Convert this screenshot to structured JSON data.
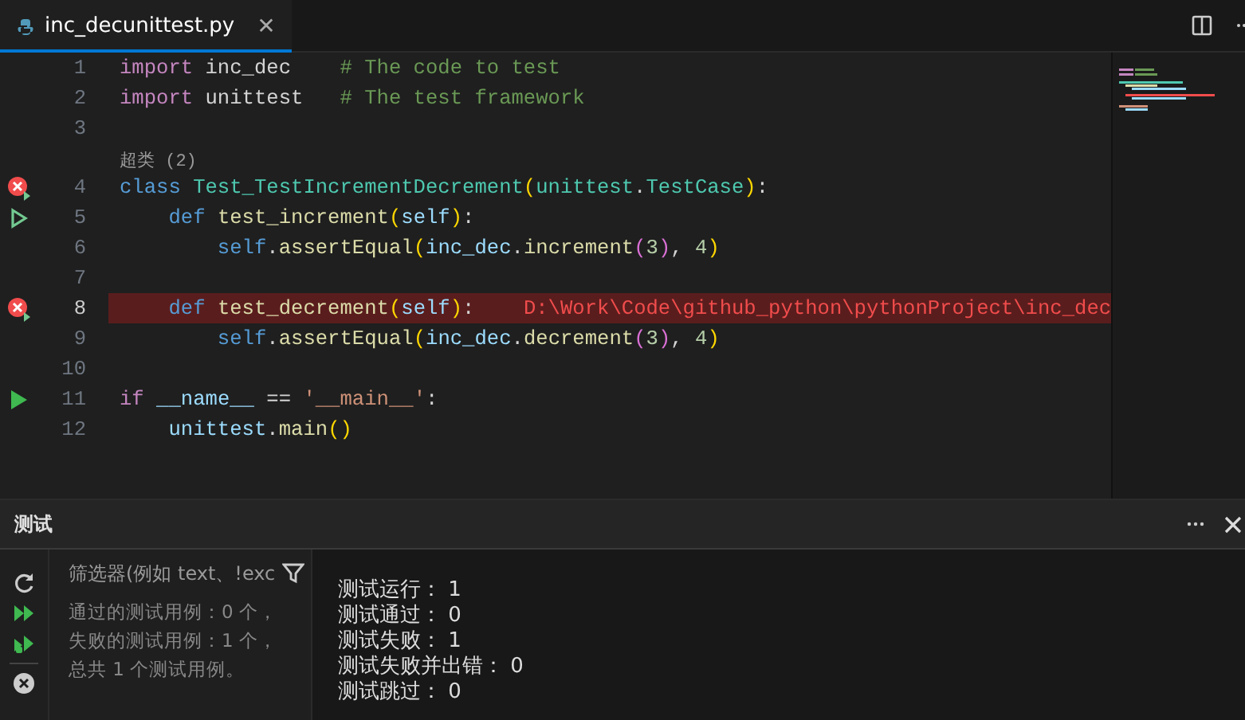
{
  "editor_tabs": [
    {
      "label": "inc_decunittest.py",
      "close": "✕",
      "selected": true
    }
  ],
  "code": {
    "lines": [
      {
        "number": "1",
        "kind": "plain",
        "highlighted": false,
        "tokens": [
          {
            "kind": "keyword",
            "text": "import"
          },
          {
            "kind": "plain",
            "text": " inc_dec    "
          },
          {
            "kind": "comment",
            "text": "# The code to test"
          }
        ]
      },
      {
        "number": "2",
        "kind": "plain",
        "highlighted": false,
        "tokens": [
          {
            "kind": "keyword",
            "text": "import"
          },
          {
            "kind": "plain",
            "text": " unittest   "
          },
          {
            "kind": "comment",
            "text": "# The test framework"
          }
        ]
      },
      {
        "number": "3",
        "kind": "plain",
        "highlighted": false
      },
      {
        "number": "4",
        "kind": "failed",
        "highlighted": false,
        "codelens": "超类 (2)",
        "tokens": [
          {
            "kind": "storage",
            "text": "class "
          },
          {
            "kind": "type",
            "text": "Test_TestIncrementDecrement"
          },
          {
            "kind": "paren",
            "text": "("
          },
          {
            "kind": "type",
            "text": "unittest"
          },
          {
            "kind": "plain",
            "text": "."
          },
          {
            "kind": "type",
            "text": "TestCase"
          },
          {
            "kind": "paren",
            "text": ")"
          },
          {
            "kind": "plain",
            "text": ":"
          }
        ]
      },
      {
        "number": "5",
        "kind": "test",
        "highlighted": false,
        "tokens": [
          {
            "kind": "storage",
            "text": "    def "
          },
          {
            "kind": "function",
            "text": "test_increment"
          },
          {
            "kind": "paren",
            "text": "("
          },
          {
            "kind": "variable",
            "text": "self"
          },
          {
            "kind": "paren",
            "text": ")"
          },
          {
            "kind": "plain",
            "text": ":"
          }
        ]
      },
      {
        "number": "6",
        "kind": "plain",
        "highlighted": false,
        "tokens": [
          {
            "kind": "storage",
            "text": "        self"
          },
          {
            "kind": "plain",
            "text": "."
          },
          {
            "kind": "function",
            "text": "assertEqual"
          },
          {
            "kind": "paren",
            "text": "("
          },
          {
            "kind": "variable",
            "text": "inc_dec"
          },
          {
            "kind": "plain",
            "text": "."
          },
          {
            "kind": "function",
            "text": "increment"
          },
          {
            "kind": "paren2",
            "text": "("
          },
          {
            "kind": "number",
            "text": "3"
          },
          {
            "kind": "paren2",
            "text": ")"
          },
          {
            "kind": "plain",
            "text": ", "
          },
          {
            "kind": "number",
            "text": "4"
          },
          {
            "kind": "paren",
            "text": ")"
          }
        ]
      },
      {
        "number": "7",
        "kind": "plain",
        "highlighted": false
      },
      {
        "number": "8",
        "kind": "failed",
        "highlighted": true,
        "tokens": [
          {
            "kind": "storage",
            "text": "    def "
          },
          {
            "kind": "function",
            "text": "test_decrement"
          },
          {
            "kind": "paren",
            "text": "("
          },
          {
            "kind": "variable",
            "text": "self"
          },
          {
            "kind": "paren",
            "text": ")"
          },
          {
            "kind": "plain",
            "text": ":    "
          },
          {
            "kind": "error",
            "text": "D:\\Work\\Code\\github_python\\pythonProject\\inc_dec"
          }
        ]
      },
      {
        "number": "9",
        "kind": "plain",
        "highlighted": false,
        "tokens": [
          {
            "kind": "storage",
            "text": "        self"
          },
          {
            "kind": "plain",
            "text": "."
          },
          {
            "kind": "function",
            "text": "assertEqual"
          },
          {
            "kind": "paren",
            "text": "("
          },
          {
            "kind": "variable",
            "text": "inc_dec"
          },
          {
            "kind": "plain",
            "text": "."
          },
          {
            "kind": "function",
            "text": "decrement"
          },
          {
            "kind": "paren2",
            "text": "("
          },
          {
            "kind": "number",
            "text": "3"
          },
          {
            "kind": "paren2",
            "text": ")"
          },
          {
            "kind": "plain",
            "text": ", "
          },
          {
            "kind": "number",
            "text": "4"
          },
          {
            "kind": "paren",
            "text": ")"
          }
        ]
      },
      {
        "number": "10",
        "kind": "plain",
        "highlighted": false
      },
      {
        "number": "11",
        "kind": "main",
        "highlighted": false,
        "tokens": [
          {
            "kind": "keyword",
            "text": "if "
          },
          {
            "kind": "variable",
            "text": "__name__"
          },
          {
            "kind": "plain",
            "text": " == "
          },
          {
            "kind": "string",
            "text": "'__main__'"
          },
          {
            "kind": "plain",
            "text": ":"
          }
        ]
      },
      {
        "number": "12",
        "kind": "plain",
        "highlighted": false,
        "tokens": [
          {
            "kind": "variable",
            "text": "    unittest"
          },
          {
            "kind": "plain",
            "text": "."
          },
          {
            "kind": "function",
            "text": "main"
          },
          {
            "kind": "paren",
            "text": "()"
          }
        ]
      }
    ]
  },
  "panel": {
    "title": "测试",
    "filter": {
      "placeholder": "筛选器(例如 text、!exc"
    },
    "summary": [
      "通过的测试用例：0 个，",
      "失败的测试用例：1 个，",
      "总共 1 个测试用例。"
    ],
    "output": [
      "测试运行： 1",
      "测试通过： 0",
      "测试失败： 1",
      "测试失败并出错： 0",
      "测试跳过： 0"
    ]
  }
}
